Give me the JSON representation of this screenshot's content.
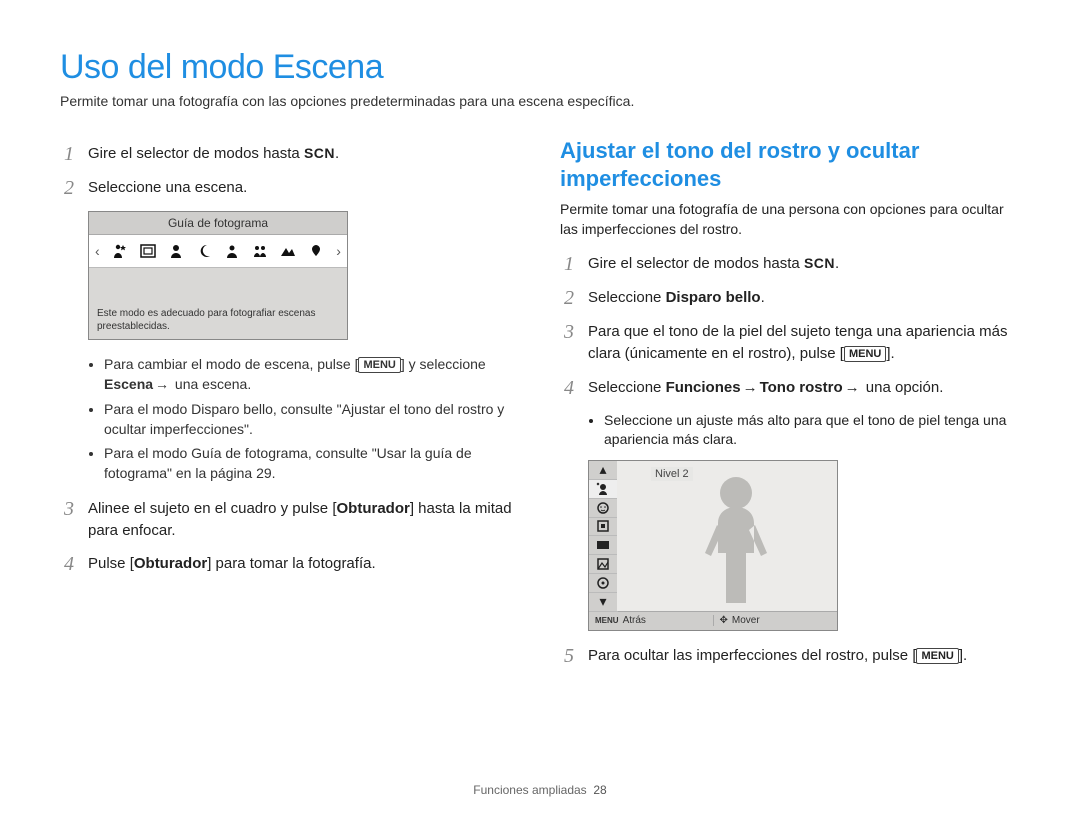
{
  "title": "Uso del modo Escena",
  "intro": "Permite tomar una fotografía con las opciones predeterminadas para una escena específica.",
  "labels": {
    "scn": "SCN",
    "menu": "MENU",
    "arrow": "→"
  },
  "left": {
    "step1_pre": "Gire el selector de modos hasta ",
    "step1_post": ".",
    "step2": "Seleccione una escena.",
    "screen": {
      "bar": "Guía de fotograma",
      "desc": "Este modo es adecuado para fotografiar escenas preestablecidas.",
      "icons": [
        "person-night-icon",
        "frame-guide-icon",
        "beauty-shot-icon",
        "night-icon",
        "portrait-icon",
        "children-icon",
        "landscape-icon",
        "closeup-icon"
      ]
    },
    "bullets": {
      "b1_pre": "Para cambiar el modo de escena, pulse [",
      "b1_mid": "] y seleccione ",
      "b1_escena": "Escena",
      "b1_post": " una escena.",
      "b2": "Para el modo Disparo bello, consulte \"Ajustar el tono del rostro y ocultar imperfecciones\".",
      "b3": "Para el modo Guía de fotograma, consulte \"Usar la guía de fotograma\" en la página 29."
    },
    "step3_pre": "Alinee el sujeto en el cuadro y pulse [",
    "step3_obt": "Obturador",
    "step3_post": "] hasta la mitad para enfocar.",
    "step4_pre": "Pulse [",
    "step4_obt": "Obturador",
    "step4_post": "] para tomar la fotografía."
  },
  "right": {
    "heading": "Ajustar el tono del rostro y ocultar imperfecciones",
    "intro": "Permite tomar una fotografía de una persona con opciones para ocultar las imperfecciones del rostro.",
    "step1_pre": "Gire el selector de modos hasta ",
    "step1_post": ".",
    "step2_pre": "Seleccione ",
    "step2_bold": "Disparo bello",
    "step2_post": ".",
    "step3_pre": "Para que el tono de la piel del sujeto tenga una apariencia más clara (únicamente en el rostro), pulse [",
    "step3_post": "].",
    "step4_pre": "Seleccione ",
    "step4_b1": "Funciones",
    "step4_b2": "Tono rostro",
    "step4_post": " una opción.",
    "sub_bullet": "Seleccione un ajuste más alto para que el tono de piel tenga una apariencia más clara.",
    "screen": {
      "label": "Nivel 2",
      "footer_left_icon": "MENU",
      "footer_left": "Atrás",
      "footer_right_icon": "✥",
      "footer_right": "Mover",
      "left_icons": [
        "up-caret-icon",
        "face-tone-icon",
        "face-retouch-icon",
        "focus-area-icon",
        "resolution-icon",
        "quality-icon",
        "acb-icon",
        "down-caret-icon"
      ]
    },
    "step5_pre": "Para ocultar las imperfecciones del rostro, pulse [",
    "step5_post": "]."
  },
  "footer": {
    "section": "Funciones ampliadas",
    "page": "28"
  }
}
